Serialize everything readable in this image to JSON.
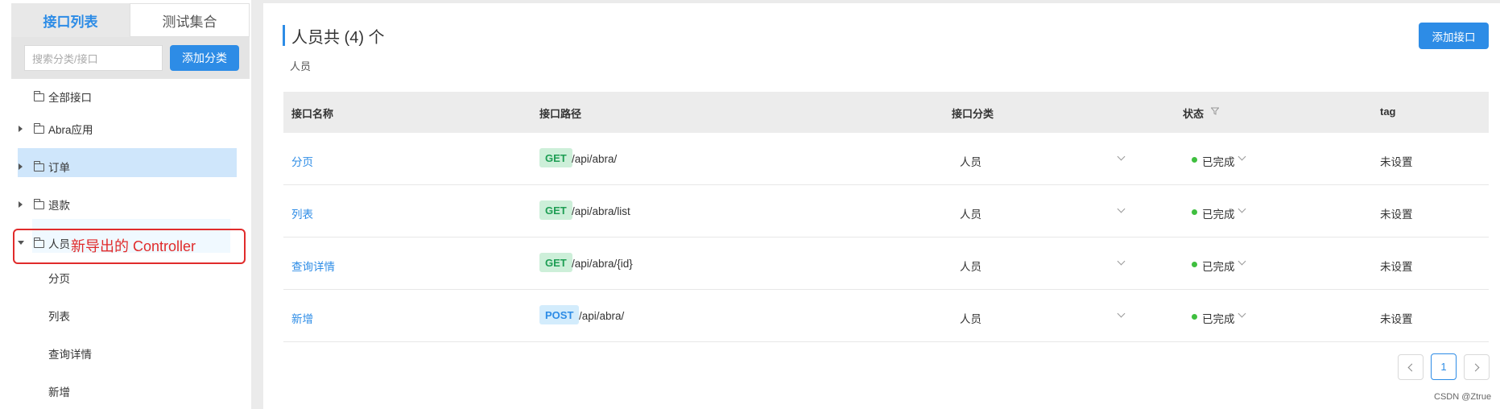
{
  "sidebar": {
    "tabs": [
      {
        "label": "接口列表",
        "active": true
      },
      {
        "label": "测试集合",
        "active": false
      }
    ],
    "search": {
      "placeholder": "搜索分类/接口"
    },
    "add_category_label": "添加分类",
    "tree": [
      {
        "label": "全部接口"
      },
      {
        "label": "Abra应用"
      },
      {
        "label": "订单"
      },
      {
        "label": "退款"
      },
      {
        "label": "人员"
      }
    ],
    "children": [
      {
        "label": "分页"
      },
      {
        "label": "列表"
      },
      {
        "label": "查询详情"
      },
      {
        "label": "新增"
      }
    ],
    "annotation": "新导出的 Controller"
  },
  "main": {
    "title": "人员共 (4) 个",
    "subtitle": "人员",
    "add_api_label": "添加接口",
    "columns": [
      "接口名称",
      "接口路径",
      "接口分类",
      "状态",
      "tag"
    ],
    "rows": [
      {
        "name": "分页",
        "method": "GET",
        "path": "/api/abra/",
        "category": "人员",
        "status": "已完成",
        "tag": "未设置"
      },
      {
        "name": "列表",
        "method": "GET",
        "path": "/api/abra/list",
        "category": "人员",
        "status": "已完成",
        "tag": "未设置"
      },
      {
        "name": "查询详情",
        "method": "GET",
        "path": "/api/abra/{id}",
        "category": "人员",
        "status": "已完成",
        "tag": "未设置"
      },
      {
        "name": "新增",
        "method": "POST",
        "path": "/api/abra/",
        "category": "人员",
        "status": "已完成",
        "tag": "未设置"
      }
    ],
    "pagination": {
      "current": "1"
    }
  },
  "watermark": "CSDN @Ztrue",
  "colors": {
    "accent": "#2d8ce6",
    "annotation": "#e02b2b",
    "status_ok": "#3fbf3f"
  }
}
